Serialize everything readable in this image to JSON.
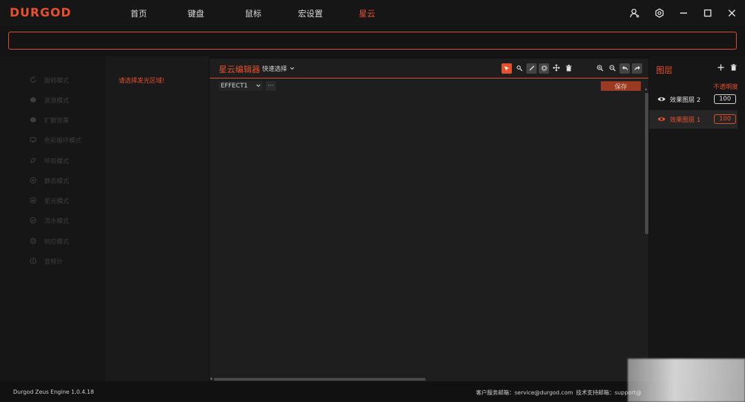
{
  "app": {
    "logo": "DURGOD",
    "nav": [
      {
        "label": "首页"
      },
      {
        "label": "键盘"
      },
      {
        "label": "鼠标"
      },
      {
        "label": "宏设置"
      },
      {
        "label": "星云"
      }
    ],
    "active_nav": "星云"
  },
  "search": {
    "value": "",
    "placeholder": ""
  },
  "modes": [
    {
      "label": "旋转模式",
      "icon": "rotate-icon"
    },
    {
      "label": "波浪模式",
      "icon": "wave-icon"
    },
    {
      "label": "扩散效果",
      "icon": "spread-icon"
    },
    {
      "label": "色彩循环模式",
      "icon": "color-cycle-icon"
    },
    {
      "label": "呼吸模式",
      "icon": "breath-icon"
    },
    {
      "label": "静态模式",
      "icon": "static-icon"
    },
    {
      "label": "星光模式",
      "icon": "star-icon"
    },
    {
      "label": "流水模式",
      "icon": "flow-icon"
    },
    {
      "label": "响应模式",
      "icon": "response-icon"
    },
    {
      "label": "音频计",
      "icon": "audio-icon"
    }
  ],
  "prompt": "请选择发光区域!",
  "editor": {
    "title": "星云编辑器",
    "quick_select": "快速选择",
    "effect": "EFFECT1",
    "more": "···",
    "save": "保存"
  },
  "layers": {
    "title": "图层",
    "opacity_label": "不透明度",
    "items": [
      {
        "name": "效果图层 2",
        "opacity": "100",
        "selected": false
      },
      {
        "name": "效果图层 1",
        "opacity": "100",
        "selected": true
      }
    ]
  },
  "footer": {
    "version": "Durgod Zeus Engine 1.0.4.18",
    "service": "客户服务邮箱：service@durgod.com",
    "support": "技术支持邮箱：support@"
  },
  "colors": {
    "accent": "#e8502c",
    "background": "#111111"
  }
}
